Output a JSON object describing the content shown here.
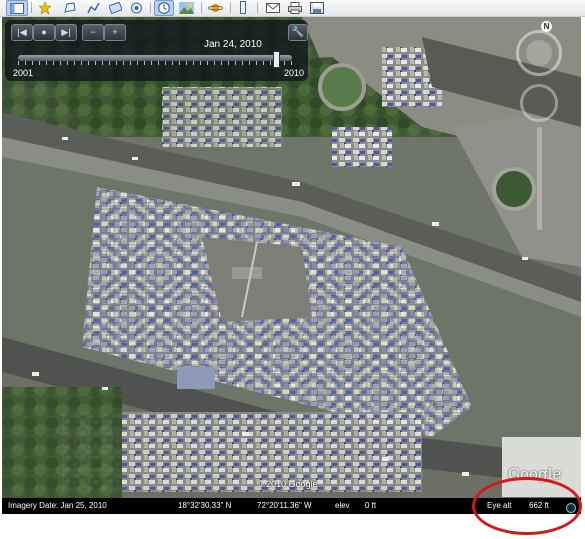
{
  "toolbar": {
    "buttons": [
      {
        "icon": "sidebar-icon",
        "active": true
      },
      {
        "icon": "placemark-icon"
      },
      {
        "icon": "polygon-icon"
      },
      {
        "icon": "path-icon"
      },
      {
        "icon": "image-overlay-icon"
      },
      {
        "icon": "record-tour-icon"
      },
      {
        "icon": "historical-imagery-icon",
        "active": true
      },
      {
        "icon": "sunlight-icon"
      },
      {
        "icon": "planet-icon"
      },
      {
        "icon": "ruler-icon"
      },
      {
        "icon": "email-icon"
      },
      {
        "icon": "print-icon"
      },
      {
        "icon": "save-image-icon"
      }
    ]
  },
  "time_slider": {
    "date": "Jan 24, 2010",
    "start_year": "2001",
    "end_year": "2010",
    "position": 0.94
  },
  "nav": {
    "north": "N"
  },
  "map": {
    "copyright": "© 2010 Google",
    "logo": "Google"
  },
  "status_bar": {
    "imagery_date": "Imagery Date: Jan 25, 2010",
    "latitude": "18°32'30.33\" N",
    "longitude": "72°20'11.36\" W",
    "elev_label": "elev",
    "elev_value": "0 ft",
    "eye_alt_label": "Eye alt",
    "eye_alt_value": "662 ft"
  },
  "annotation": {
    "color": "#d4191d"
  },
  "colors": {
    "toolbar_accent": "#3a64a8"
  }
}
